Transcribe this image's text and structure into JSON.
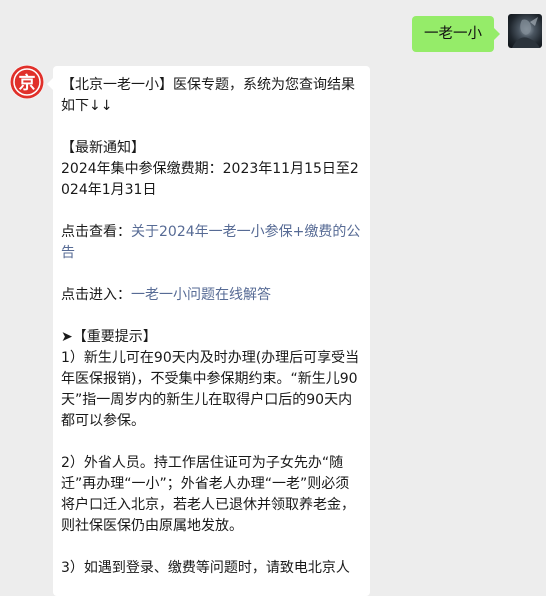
{
  "outgoing": {
    "text": "一老一小"
  },
  "incoming": {
    "avatar_char": "京",
    "intro": "【北京一老一小】医保专题，系统为您查询结果如下↓↓",
    "notice_title": "【最新通知】",
    "notice_body": "2024年集中参保缴费期：2023年11月15日至2024年1月31日",
    "view_prefix": "点击查看：",
    "view_link": "关于2024年一老一小参保+缴费的公告",
    "enter_prefix": "点击进入：",
    "enter_link": "一老一小问题在线解答",
    "tips_title": "➤【重要提示】",
    "tip1": "1）新生儿可在90天内及时办理(办理后可享受当年医保报销)，不受集中参保期约束。“新生儿90天”指一周岁内的新生儿在取得户口后的90天内都可以参保。",
    "tip2": "2）外省人员。持工作居住证可为子女先办“随迁”再办理“一小”；外省老人办理“一老”则必须将户口迁入北京，若老人已退休并领取养老金，则社保医保仍由原属地发放。",
    "tip3": "3）如遇到登录、缴费等问题时，请致电北京人"
  },
  "colors": {
    "outgoing_bubble": "#95ec69",
    "incoming_bubble": "#ffffff",
    "link": "#576b95",
    "background": "#ededed",
    "logo_red": "#e0302a"
  }
}
